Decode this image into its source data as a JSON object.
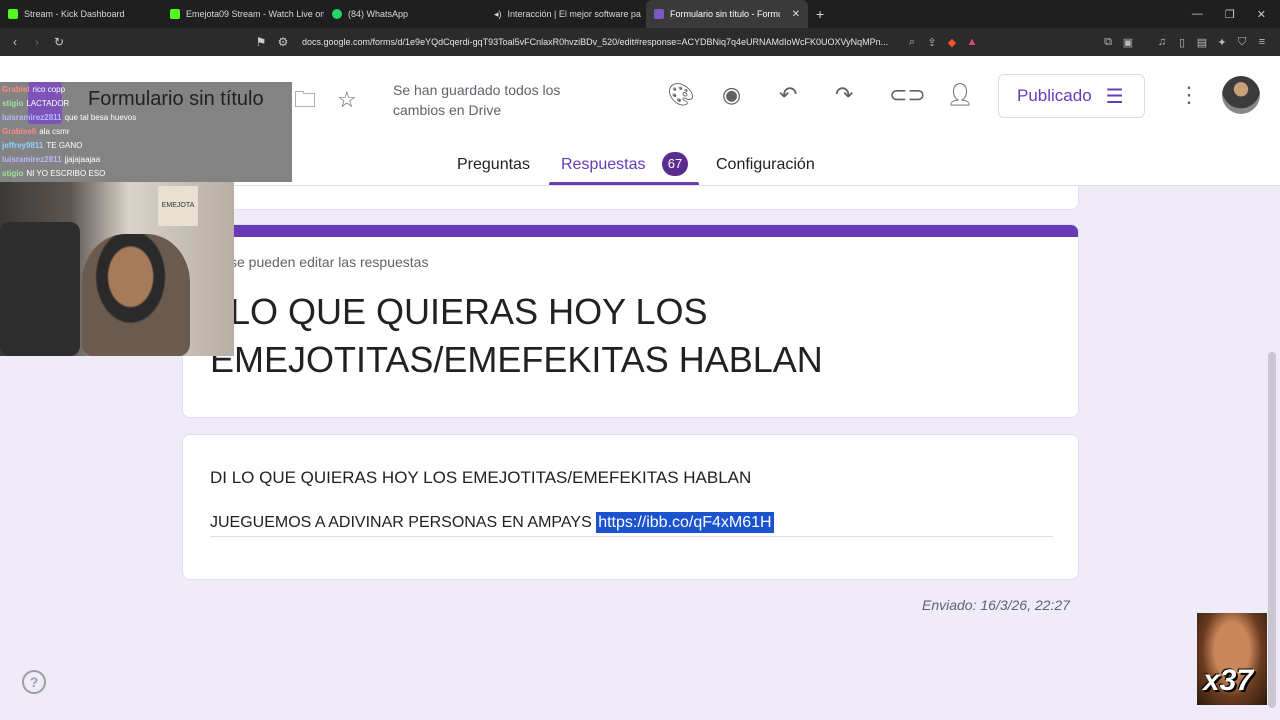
{
  "browser": {
    "tabs": [
      {
        "title": "Stream - Kick Dashboard",
        "fav_color": "#53fc18"
      },
      {
        "title": "Emejota09 Stream - Watch Live on K",
        "fav_color": "#53fc18"
      },
      {
        "title": "(84) WhatsApp",
        "fav_color": "#25d366"
      },
      {
        "title": "Interacción | El mejor software pa",
        "fav_color": "#ffffff"
      },
      {
        "title": "Formulario sin título - Formulari",
        "fav_color": "#7e57c2"
      }
    ],
    "new_tab": "+",
    "url": "docs.google.com/forms/d/1e9eYQdCqerdi-gqT93Toal5vFCnlaxR0hvziBDv_520/edit#response=ACYDBNiq7q4eURNAMdIoWcFK0UOXVyNqMPn..."
  },
  "forms": {
    "title": "Formulario sin título",
    "save_status": "Se han guardado todos los cambios en Drive",
    "publish_label": "Publicado",
    "tabs": {
      "questions": "Preguntas",
      "responses": "Respuestas",
      "settings": "Configuración"
    },
    "response_count": "67",
    "note": "se pueden editar las respuestas",
    "form_title": "I LO QUE QUIERAS HOY LOS EMEJOTITAS/EMEFEKITAS HABLAN",
    "question_title": "DI LO QUE QUIERAS HOY LOS EMEJOTITAS/EMEFEKITAS HABLAN",
    "answer_text": "JUEGUEMOS A ADIVINAR PERSONAS EN AMPAYS ",
    "answer_link": "https://ibb.co/qF4xM61H",
    "submitted": "Enviado: 16/3/26, 22:27",
    "accent_color": "#673ab7"
  },
  "chat": {
    "messages": [
      {
        "user": "Grabiel",
        "text": "rico copp"
      },
      {
        "user": "stigio",
        "text": "LACTADOR"
      },
      {
        "user": "luisramirez2811",
        "text": "que tal besa huevos"
      },
      {
        "user": "Grabiseli",
        "text": "ala csmr"
      },
      {
        "user": "jeffrey9811",
        "text": "TE GANO"
      },
      {
        "user": "luisramirez2811",
        "text": "jjajajaajaa"
      },
      {
        "user": "stigio",
        "text": "NI YO ESCRIBO ESO"
      }
    ]
  },
  "webcam": {
    "poster_text": "EMEJOTA"
  },
  "meme": {
    "label": "x37"
  },
  "help": "?"
}
